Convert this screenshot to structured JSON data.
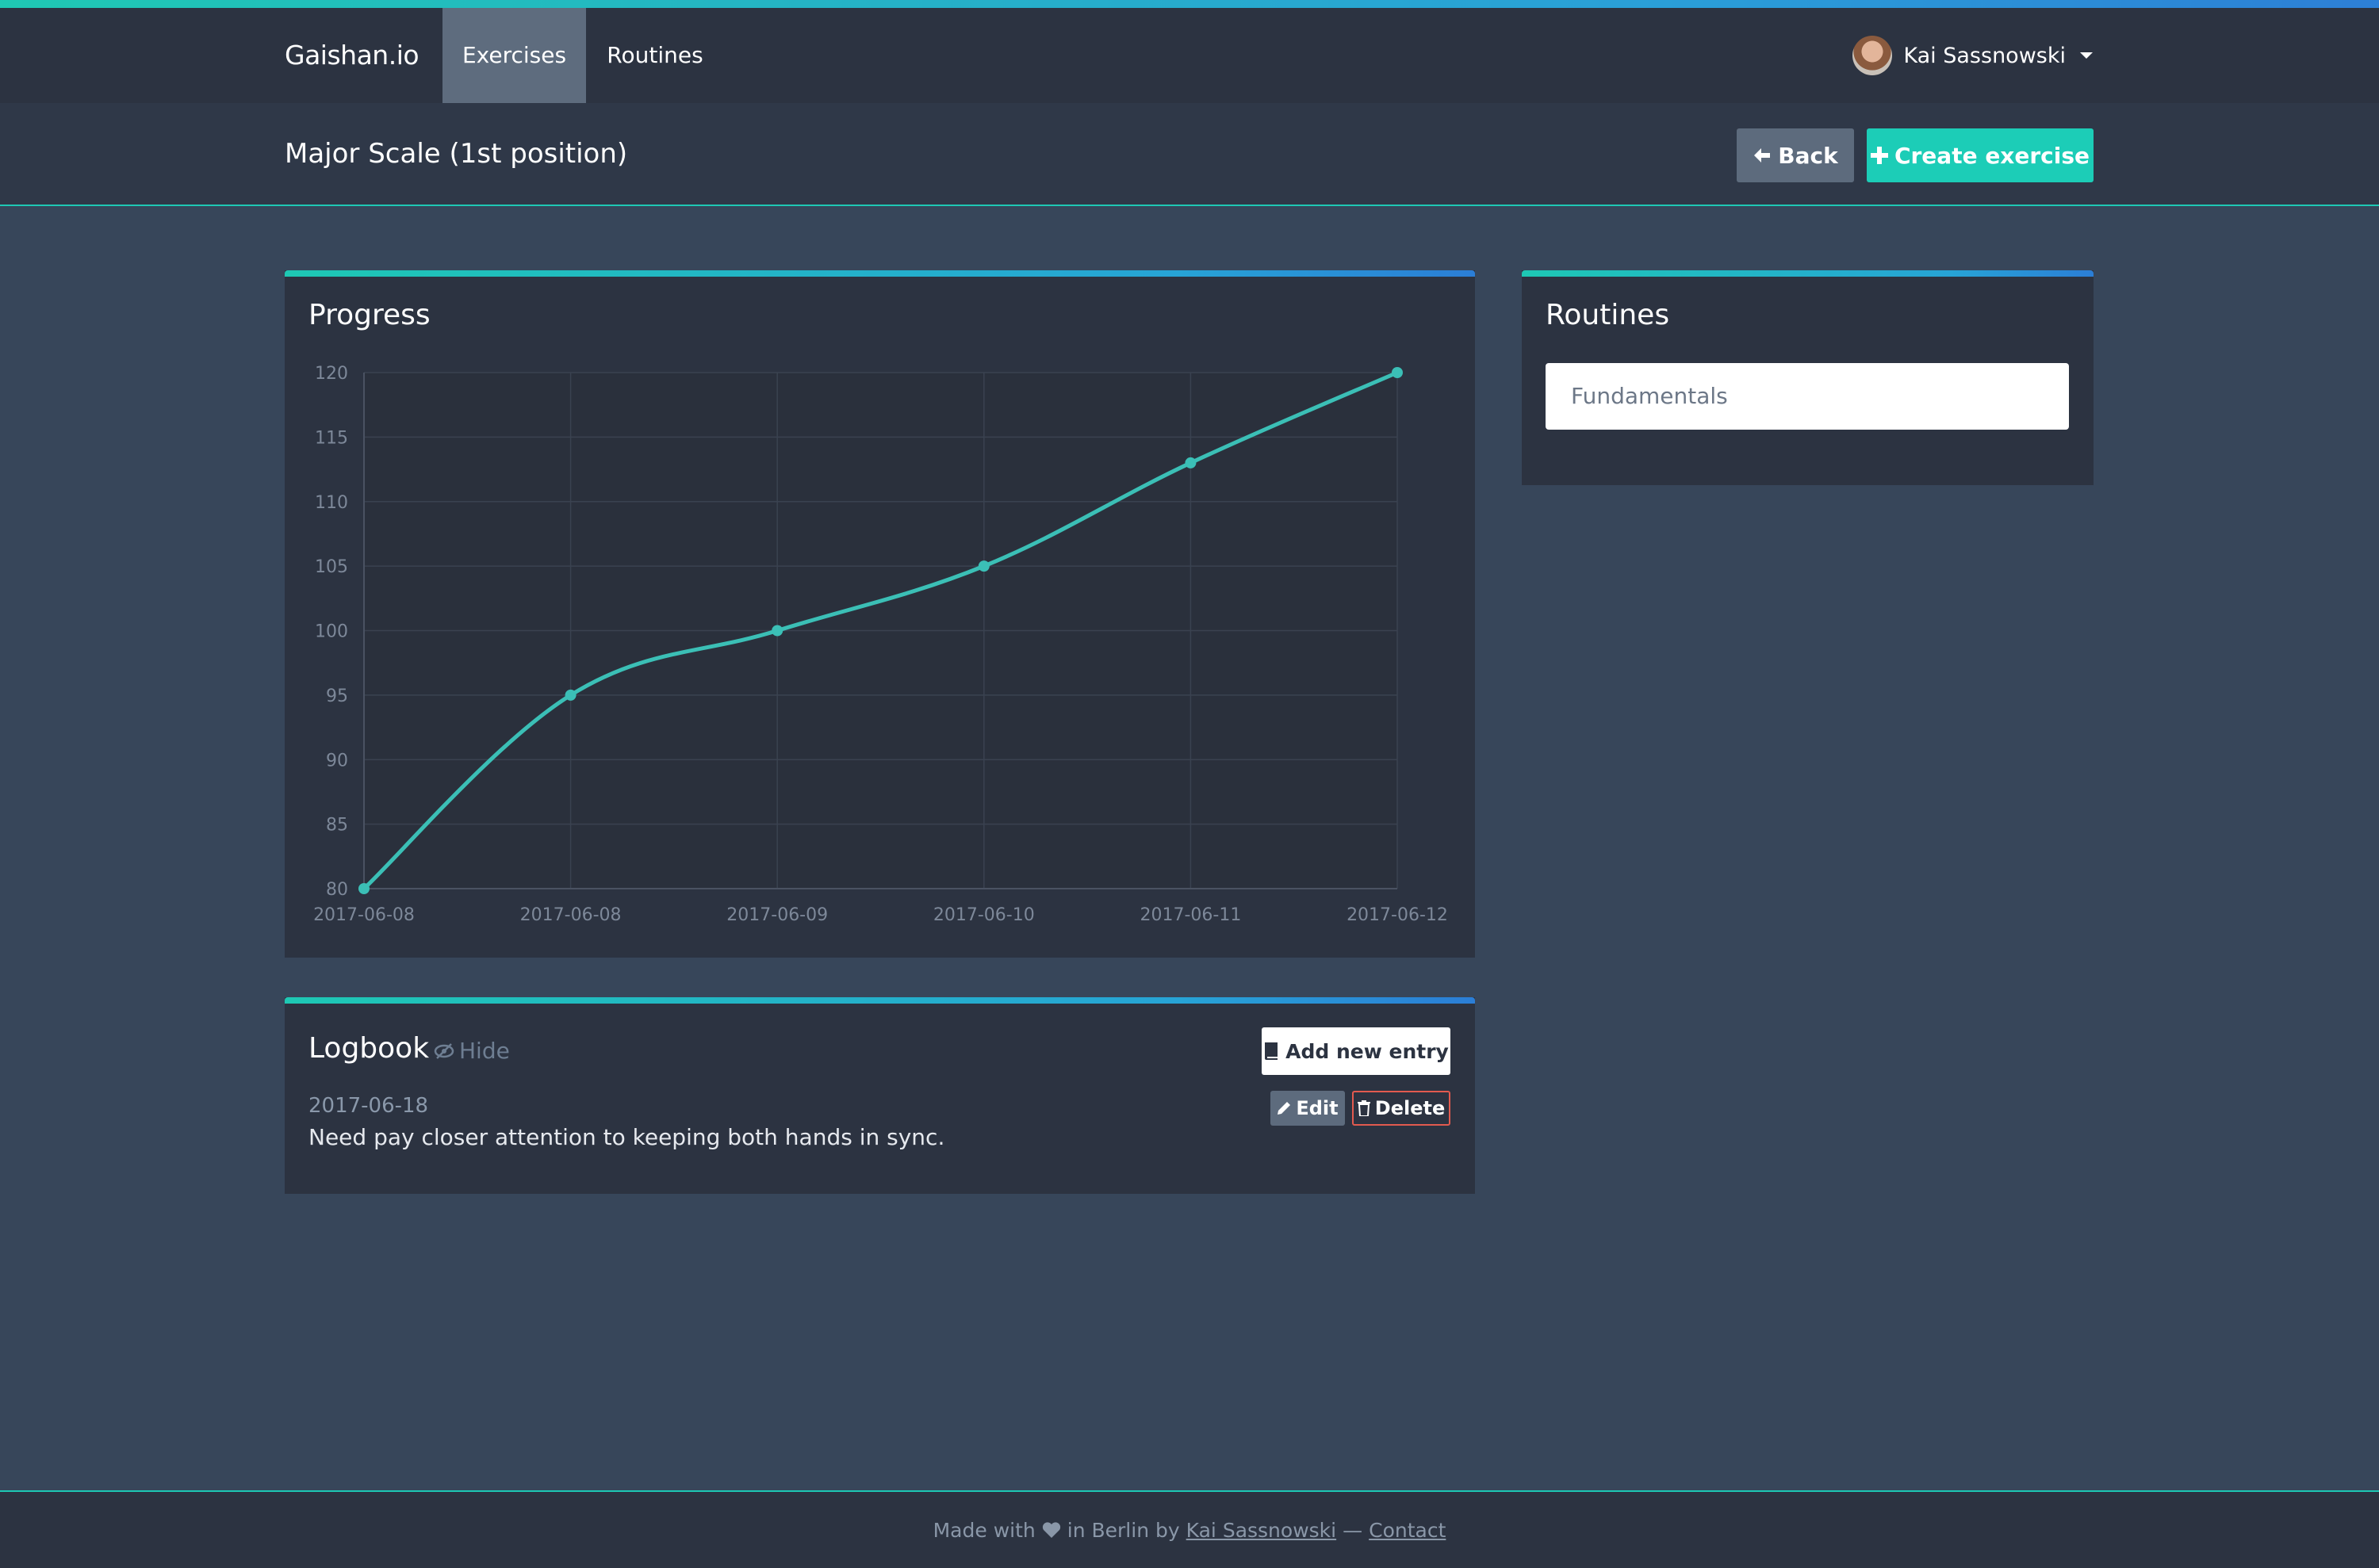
{
  "nav": {
    "brand": "Gaishan.io",
    "items": [
      {
        "label": "Exercises",
        "active": true
      },
      {
        "label": "Routines",
        "active": false
      }
    ],
    "user_name": "Kai Sassnowski"
  },
  "header": {
    "title": "Major Scale (1st position)",
    "back_label": "Back",
    "create_label": "Create exercise"
  },
  "progress": {
    "title": "Progress"
  },
  "chart_data": {
    "type": "line",
    "x": [
      "2017-06-08",
      "2017-06-08",
      "2017-06-09",
      "2017-06-10",
      "2017-06-11",
      "2017-06-12"
    ],
    "series": [
      {
        "values": [
          80,
          95,
          100,
          105,
          113,
          120
        ]
      }
    ],
    "yticks": [
      80,
      85,
      90,
      95,
      100,
      105,
      110,
      115,
      120
    ],
    "ylim": [
      80,
      120
    ],
    "grid": true,
    "title": "",
    "xlabel": "",
    "ylabel": "",
    "line_color": "#3bbfb6"
  },
  "routines": {
    "title": "Routines",
    "items": [
      "Fundamentals"
    ]
  },
  "logbook": {
    "title": "Logbook",
    "hide_label": "Hide",
    "add_label": "Add new entry",
    "entries": [
      {
        "date": "2017-06-18",
        "text": "Need pay closer attention to keeping both hands in sync.",
        "edit_label": "Edit",
        "delete_label": "Delete"
      }
    ]
  },
  "footer": {
    "made_with": "Made with",
    "in_berlin_by": "in Berlin by",
    "author": "Kai Sassnowski",
    "separator": "—",
    "contact": "Contact"
  },
  "colors": {
    "accent": "#1ccdb7",
    "danger": "#e25a4f",
    "background": "#37465a",
    "panel": "#2c3341"
  }
}
